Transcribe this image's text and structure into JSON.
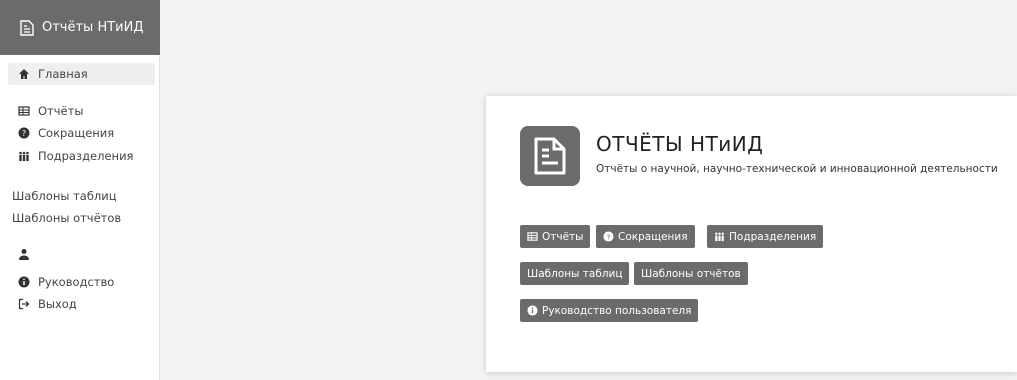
{
  "sidebar": {
    "brand": "Отчёты НТиИД",
    "home": "Главная",
    "reports": "Отчёты",
    "abbreviations": "Сокращения",
    "departments": "Подразделения",
    "table_templates": "Шаблоны таблиц",
    "report_templates": "Шаблоны отчётов",
    "guide": "Руководство",
    "logout": "Выход"
  },
  "main": {
    "title": "ОТЧЁТЫ НТиИД",
    "subtitle": "Отчёты о научной, научно-технической и инновационной деятельности",
    "buttons": {
      "reports": "Отчёты",
      "abbreviations": "Сокращения",
      "departments": "Подразделения",
      "table_templates": "Шаблоны таблиц",
      "report_templates": "Шаблоны отчётов",
      "user_guide": "Руководство пользователя"
    }
  },
  "colors": {
    "accent": "#6b6b6b",
    "background": "#f3f3f3",
    "card": "#ffffff"
  }
}
